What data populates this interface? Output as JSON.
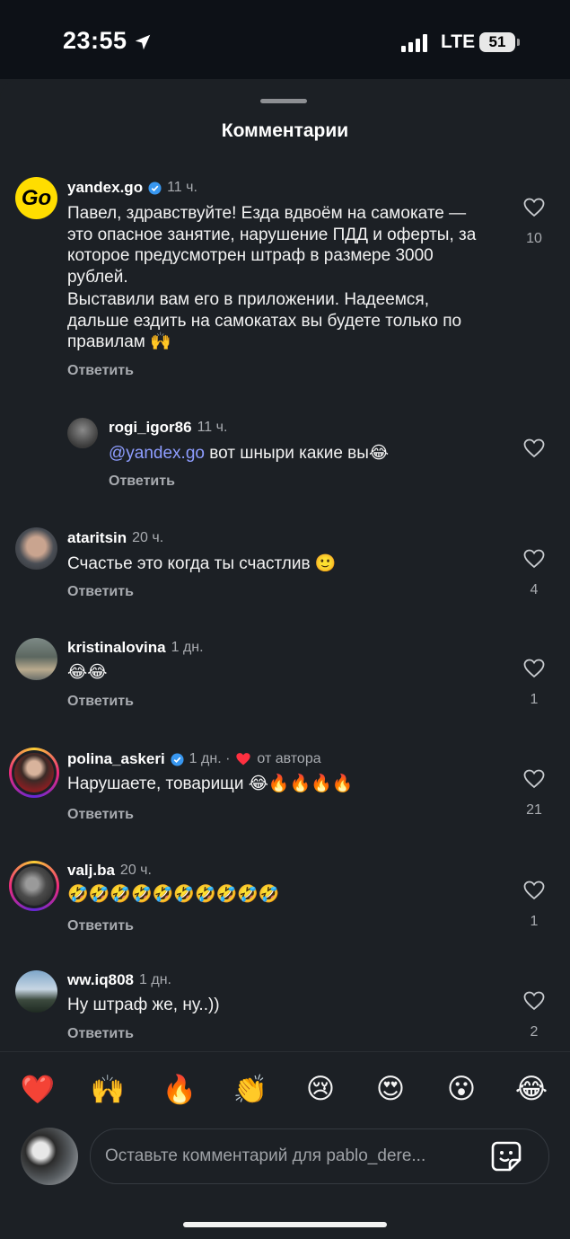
{
  "status": {
    "time": "23:55",
    "network": "LTE",
    "battery": "51"
  },
  "sheet": {
    "title": "Комментарии"
  },
  "comments": [
    {
      "user": "yandex.go",
      "time": "11 ч.",
      "p1": "Павел, здравствуйте! Езда вдвоём на самокате — это опасное занятие, нарушение ПДД и оферты, за которое предусмотрен штраф в размере 3000 рублей.",
      "p2": "Выставили вам его в приложении. Надеемся, дальше ездить на самокатах вы будете только по правилам 🙌",
      "reply": "Ответить",
      "likes": "10"
    },
    {
      "user": "rogi_igor86",
      "time": "11 ч.",
      "mention": "@yandex.go",
      "text": " вот шныри какие вы😂",
      "reply": "Ответить"
    },
    {
      "user": "ataritsin",
      "time": "20 ч.",
      "text": "Счастье это когда ты счастлив 🙂",
      "reply": "Ответить",
      "likes": "4"
    },
    {
      "user": "kristinalovina",
      "time": "1 дн.",
      "text": "😂😂",
      "reply": "Ответить",
      "likes": "1"
    },
    {
      "user": "polina_askeri",
      "time": "1 дн. ·",
      "author_badge": "от автора",
      "text": "Нарушаете, товарищи 😂🔥🔥🔥🔥",
      "reply": "Ответить",
      "likes": "21"
    },
    {
      "user": "valj.ba",
      "time": "20 ч.",
      "text": "🤣🤣🤣🤣🤣🤣🤣🤣🤣🤣",
      "reply": "Ответить",
      "likes": "1"
    },
    {
      "user": "ww.iq808",
      "time": "1 дн.",
      "text": "Ну штраф же, ну..))",
      "reply": "Ответить",
      "likes": "2"
    }
  ],
  "reactions": [
    "❤️",
    "🙌",
    "🔥",
    "👏",
    "😢",
    "😍",
    "😮",
    "😂"
  ],
  "composer": {
    "placeholder": "Оставьте комментарий для pablo_dere..."
  },
  "colors": {
    "background": "#1c2025",
    "mention": "#8e9dff",
    "heart": "#ff3040",
    "verified": "#3897f0"
  }
}
